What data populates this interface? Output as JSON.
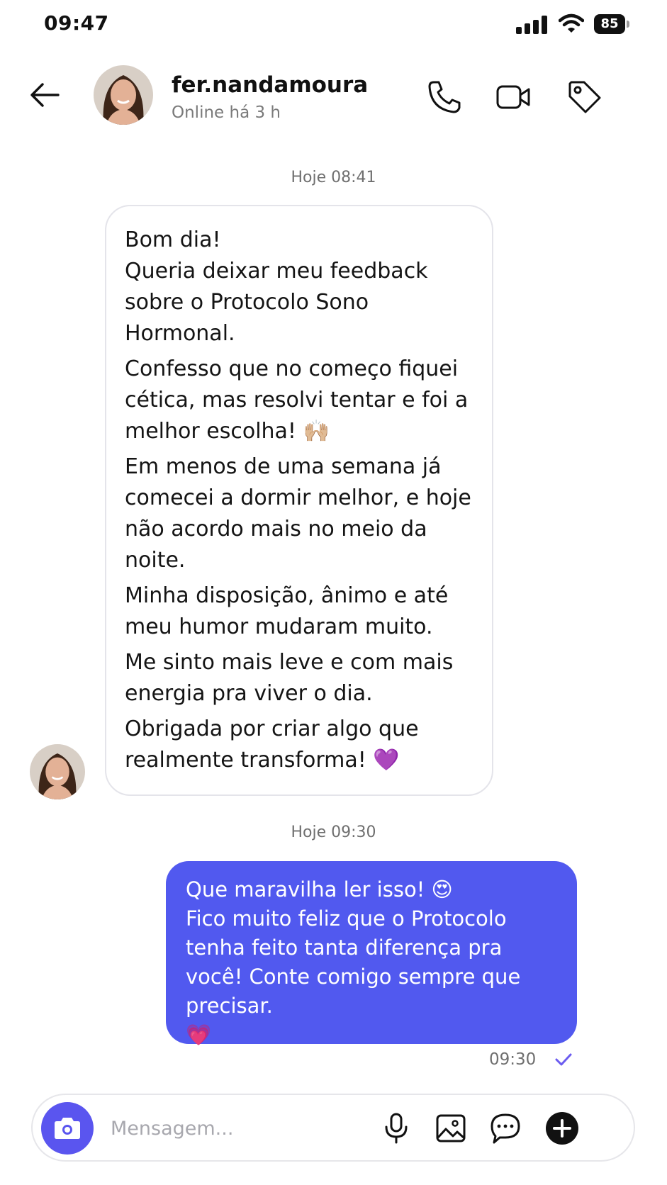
{
  "status_bar": {
    "time": "09:47",
    "battery": "85"
  },
  "header": {
    "username": "fer.nandamoura",
    "presence": "Online há 3 h"
  },
  "conversation": {
    "timestamp_1": "Hoje 08:41",
    "incoming_message": {
      "paragraphs": [
        "Bom dia!\nQueria deixar meu feedback sobre o Protocolo Sono Hormonal.",
        "Confesso que no começo fiquei cética, mas resolvi tentar e foi a melhor escolha! 🙌🏼",
        "Em menos de uma semana já comecei a dormir melhor, e hoje não acordo mais no meio da noite.",
        "Minha disposição, ânimo e até meu humor mudaram muito.",
        "Me sinto mais leve e com mais energia pra viver o dia.",
        "Obrigada por criar algo que realmente transforma! 💜"
      ]
    },
    "timestamp_2": "Hoje 09:30",
    "outgoing_message": {
      "text": "Que maravilha ler isso! 😍\nFico muito feliz que o Protocolo tenha feito tanta diferença pra você! Conte comigo sempre que precisar.\n💗",
      "time": "09:30",
      "status": "read"
    }
  },
  "composer": {
    "placeholder": "Mensagem..."
  },
  "icons": {
    "header": [
      "back-arrow-icon",
      "phone-icon",
      "video-camera-icon",
      "tag-icon"
    ],
    "composer": [
      "camera-icon",
      "microphone-icon",
      "image-icon",
      "chat-bubble-icon",
      "plus-icon"
    ]
  },
  "colors": {
    "accent": "#5159ef",
    "camera_button": "#5a55ef",
    "check": "#6b5cf0",
    "muted_text": "#6f6f6f"
  }
}
